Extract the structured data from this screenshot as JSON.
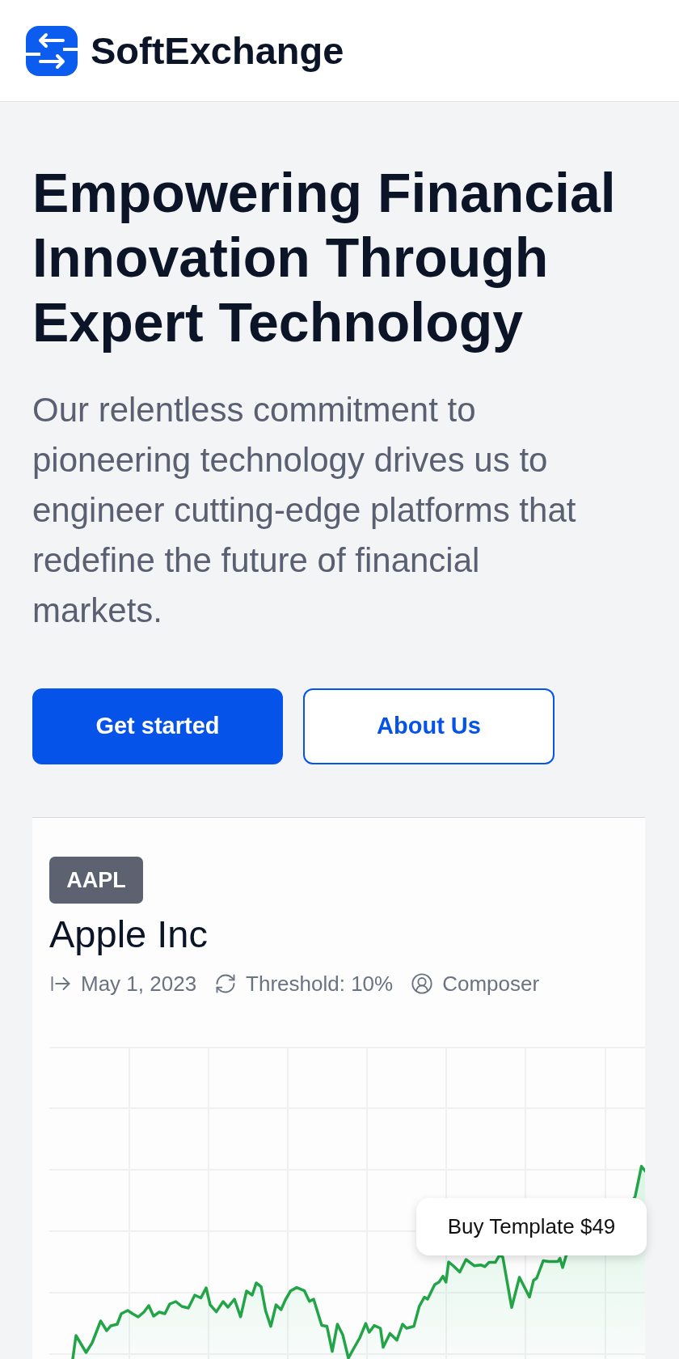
{
  "header": {
    "brand": "SoftExchange"
  },
  "hero": {
    "title": "Empowering Financial Innovation Through Expert Technology",
    "description": "Our relentless commitment to pioneering technology drives us to engineer cutting-edge platforms that redefine the future of financial markets.",
    "buttons": [
      {
        "label": "Get started",
        "kind": "primary"
      },
      {
        "label": "About Us",
        "kind": "outline"
      }
    ]
  },
  "card": {
    "ticker": "AAPL",
    "company": "Apple Inc",
    "meta": [
      {
        "kind": "date",
        "text": "May 1, 2023"
      },
      {
        "kind": "threshold",
        "text": "Threshold: 10%"
      },
      {
        "kind": "author",
        "text": "Composer"
      }
    ]
  },
  "floating_button": {
    "label": "Buy Template $49"
  }
}
